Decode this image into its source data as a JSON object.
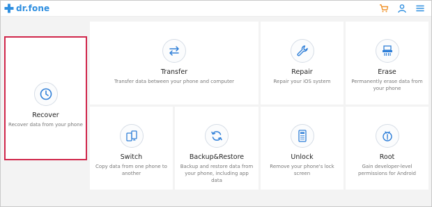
{
  "app": {
    "logo_text": "dr.fone"
  },
  "header": {
    "icons": [
      "cart-icon",
      "user-icon",
      "menu-icon"
    ],
    "accent": "#2f8fe0",
    "cart_color": "#f0932b"
  },
  "cards": {
    "recover": {
      "title": "Recover",
      "desc": "Recover data from your phone",
      "icon": "clock-icon",
      "selected": true
    },
    "transfer": {
      "title": "Transfer",
      "desc": "Transfer data between your phone and computer",
      "icon": "transfer-arrows-icon"
    },
    "repair": {
      "title": "Repair",
      "desc": "Repair your iOS system",
      "icon": "wrench-icon"
    },
    "erase": {
      "title": "Erase",
      "desc": "Permanently erase data from your phone",
      "icon": "shredder-icon"
    },
    "switch": {
      "title": "Switch",
      "desc": "Copy data from one phone to another",
      "icon": "phone-switch-icon"
    },
    "backup": {
      "title": "Backup&Restore",
      "desc": "Backup and restore data from your phone, including app data",
      "icon": "sync-icon"
    },
    "unlock": {
      "title": "Unlock",
      "desc": "Remove your phone's lock screen",
      "icon": "keypad-phone-icon"
    },
    "root": {
      "title": "Root",
      "desc": "Gain developer-level permissions for Android",
      "icon": "android-root-icon"
    }
  },
  "colors": {
    "selection": "#d0264a",
    "icon_blue": "#2f7fd8"
  }
}
